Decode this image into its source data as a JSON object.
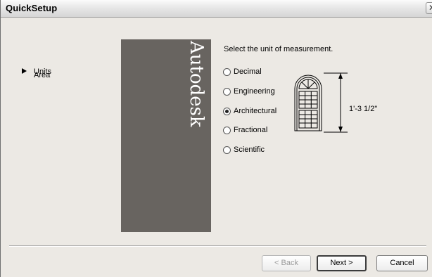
{
  "window": {
    "title": "QuickSetup",
    "close_icon": "close-icon"
  },
  "nav": {
    "items": [
      {
        "label": "Units",
        "selected": true
      },
      {
        "label": "Area",
        "selected": false
      }
    ],
    "current_icon": "triangle-right-icon"
  },
  "banner": {
    "brand": "Autodesk",
    "color": "#686460"
  },
  "units": {
    "instruction": "Select the unit of measurement.",
    "options": [
      {
        "label": "Decimal",
        "selected": false
      },
      {
        "label": "Engineering",
        "selected": false
      },
      {
        "label": "Architectural",
        "selected": true
      },
      {
        "label": "Fractional",
        "selected": false
      },
      {
        "label": "Scientific",
        "selected": false
      }
    ],
    "preview_measurement": "1'-3 1/2\""
  },
  "buttons": {
    "back": "< Back",
    "next": "Next >",
    "cancel": "Cancel"
  }
}
